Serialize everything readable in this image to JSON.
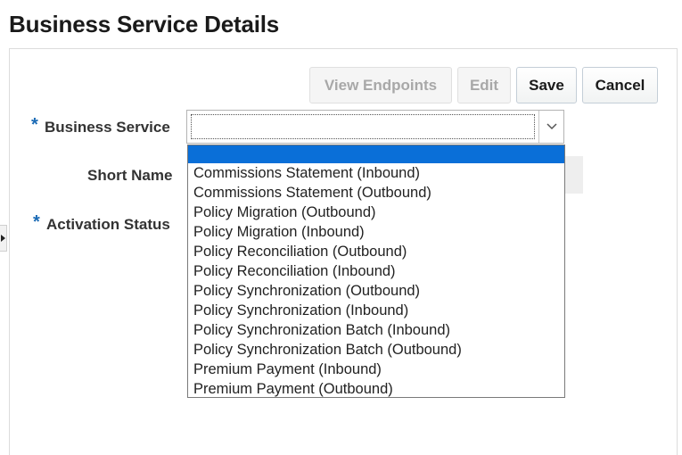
{
  "page": {
    "title": "Business Service Details"
  },
  "toolbar": {
    "view_endpoints_label": "View Endpoints",
    "edit_label": "Edit",
    "save_label": "Save",
    "cancel_label": "Cancel"
  },
  "form": {
    "required_marker": "*",
    "business_service_label": "Business Service",
    "short_name_label": "Short Name",
    "activation_status_label": "Activation Status",
    "business_service_value": ""
  },
  "dropdown": {
    "selected_index": 0,
    "options": [
      "",
      "Commissions Statement (Inbound)",
      "Commissions Statement (Outbound)",
      "Policy Migration (Outbound)",
      "Policy Migration (Inbound)",
      "Policy Reconciliation (Outbound)",
      "Policy Reconciliation (Inbound)",
      "Policy Synchronization (Outbound)",
      "Policy Synchronization (Inbound)",
      "Policy Synchronization Batch (Inbound)",
      "Policy Synchronization Batch (Outbound)",
      "Premium Payment (Inbound)",
      "Premium Payment (Outbound)"
    ]
  },
  "colors": {
    "required_marker": "#1a6ab5",
    "selected_option": "#0a6fd8"
  }
}
